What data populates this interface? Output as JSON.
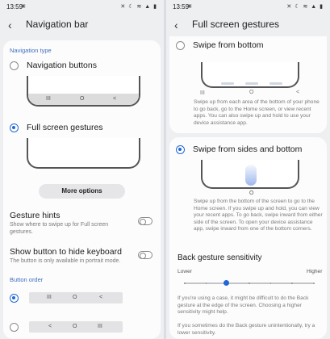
{
  "status_left": {
    "time": "13:59",
    "indicator": "▣",
    "icons": "✕ ☾ ≋ ▲ ▮"
  },
  "status_right": {
    "time": "13:59",
    "indicator": "▣",
    "icons": "✕ ☾ ≋ ▲ ▮"
  },
  "left": {
    "title": "Navigation bar",
    "nav_type_label": "Navigation type",
    "option_buttons": "Navigation buttons",
    "option_gestures": "Full screen gestures",
    "more_options": "More options",
    "gesture_hints": {
      "title": "Gesture hints",
      "sub": "Show where to swipe up for Full screen gestures."
    },
    "hide_keyboard": {
      "title": "Show button to hide keyboard",
      "sub": "The button is only available in portrait mode."
    },
    "button_order_label": "Button order",
    "nav_icons": {
      "recent": "III",
      "home": "O",
      "back": "<"
    },
    "order1": {
      "a": "III",
      "b": "O",
      "c": "<"
    },
    "order2": {
      "a": "<",
      "b": "O",
      "c": "III"
    }
  },
  "right": {
    "title": "Full screen gestures",
    "swipe_bottom": {
      "title": "Swipe from bottom",
      "desc": "Swipe up from each area of the bottom of your phone to go back, go to the Home screen, or view recent apps. You can also swipe up and hold to use your device assistance app."
    },
    "swipe_sides": {
      "title": "Swipe from sides and bottom",
      "desc": "Swipe up from the bottom of the screen to go to the Home screen. If you swipe up and hold, you can view your recent apps. To go back, swipe inward from either side of the screen. To open your device assistance app, swipe inward from one of the bottom corners."
    },
    "sensitivity": {
      "title": "Back gesture sensitivity",
      "lower": "Lower",
      "higher": "Higher",
      "level": 0.33,
      "desc1": "If you're using a case, it might be difficult to do the Back gesture at the edge of the screen. Choosing a higher sensitivity might help.",
      "desc2": "If you sometimes do the Back gesture unintentionally, try a lower sensitivity."
    },
    "home_icon": "O"
  },
  "colors": {
    "accent": "#1f68d6",
    "section_label": "#3e6fbe"
  }
}
